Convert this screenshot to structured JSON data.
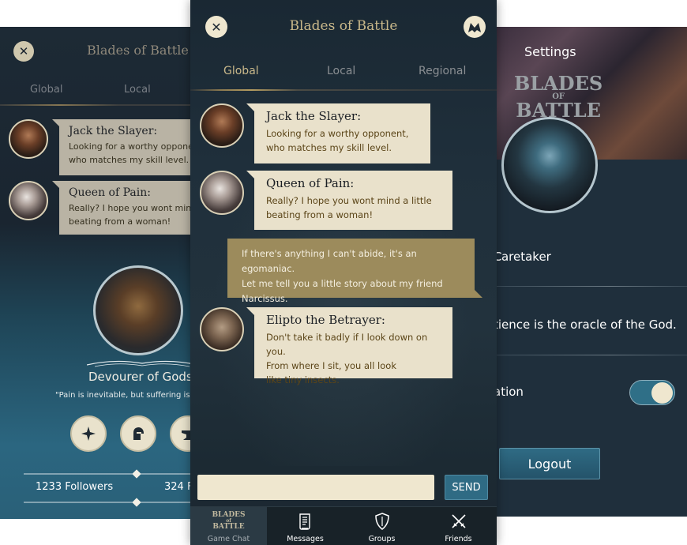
{
  "app_title": "Blades of Battle",
  "left_screen": {
    "title": "Blades of Battle",
    "tabs": [
      "Global",
      "Local"
    ],
    "messages": [
      {
        "name": "Jack the Slayer:",
        "lines": [
          "Looking for a worthy opponent",
          "who matches my skill level."
        ]
      },
      {
        "name": "Queen of Pain:",
        "lines": [
          "Really? I hope you wont mind",
          "beating from a woman!"
        ]
      }
    ],
    "profile_name": "Devourer of Gods",
    "profile_quote": "\"Pain is inevitable, but suffering is o",
    "followers": "1233 Followers",
    "following": "324 F"
  },
  "center_screen": {
    "title": "Blades of Battle",
    "tabs": [
      {
        "label": "Global",
        "active": true
      },
      {
        "label": "Local",
        "active": false
      },
      {
        "label": "Regional",
        "active": false
      }
    ],
    "messages": [
      {
        "name": "Jack the Slayer:",
        "lines": [
          "Looking for a worthy opponent,",
          "who matches my skill level."
        ]
      },
      {
        "name": "Queen of Pain:",
        "lines": [
          "Really? I hope you wont mind a little",
          "beating from a woman!"
        ]
      },
      {
        "own": true,
        "lines": [
          "If there's anything I can't abide, it's an egomaniac.",
          "Let me tell you a little story about my friend",
          "Narcissus."
        ]
      },
      {
        "name": "Elipto the Betrayer:",
        "lines": [
          "Don't take it badly if I look down on you.",
          "From where I sit, you all look",
          "like tiny insects."
        ]
      }
    ],
    "input_placeholder": "",
    "send_label": "SEND",
    "nav": [
      {
        "label": "Game Chat",
        "icon": "blades-of-battle-logo-icon",
        "logo_lines": [
          "BLADES",
          "of",
          "BATTLE"
        ],
        "active": true
      },
      {
        "label": "Messages",
        "icon": "scroll-icon",
        "active": false
      },
      {
        "label": "Groups",
        "icon": "shield-icon",
        "active": false
      },
      {
        "label": "Friends",
        "icon": "crossed-swords-icon",
        "active": false
      }
    ]
  },
  "right_screen": {
    "title": "Settings",
    "logo_lines": [
      "BLADES",
      "OF",
      "BATTLE"
    ],
    "profile_name": "Caretaker",
    "status_text": "tience is the oracle of the God.",
    "notifications_label": "ation",
    "notifications_on": true,
    "logout_label": "Logout"
  },
  "colors": {
    "accent_gold": "#c9b88a",
    "bubble_cream": "#e9e1cb",
    "own_bubble": "#9c8b5c",
    "button_blue": "#2f6b84",
    "panel_dark": "#1f2f3b"
  }
}
